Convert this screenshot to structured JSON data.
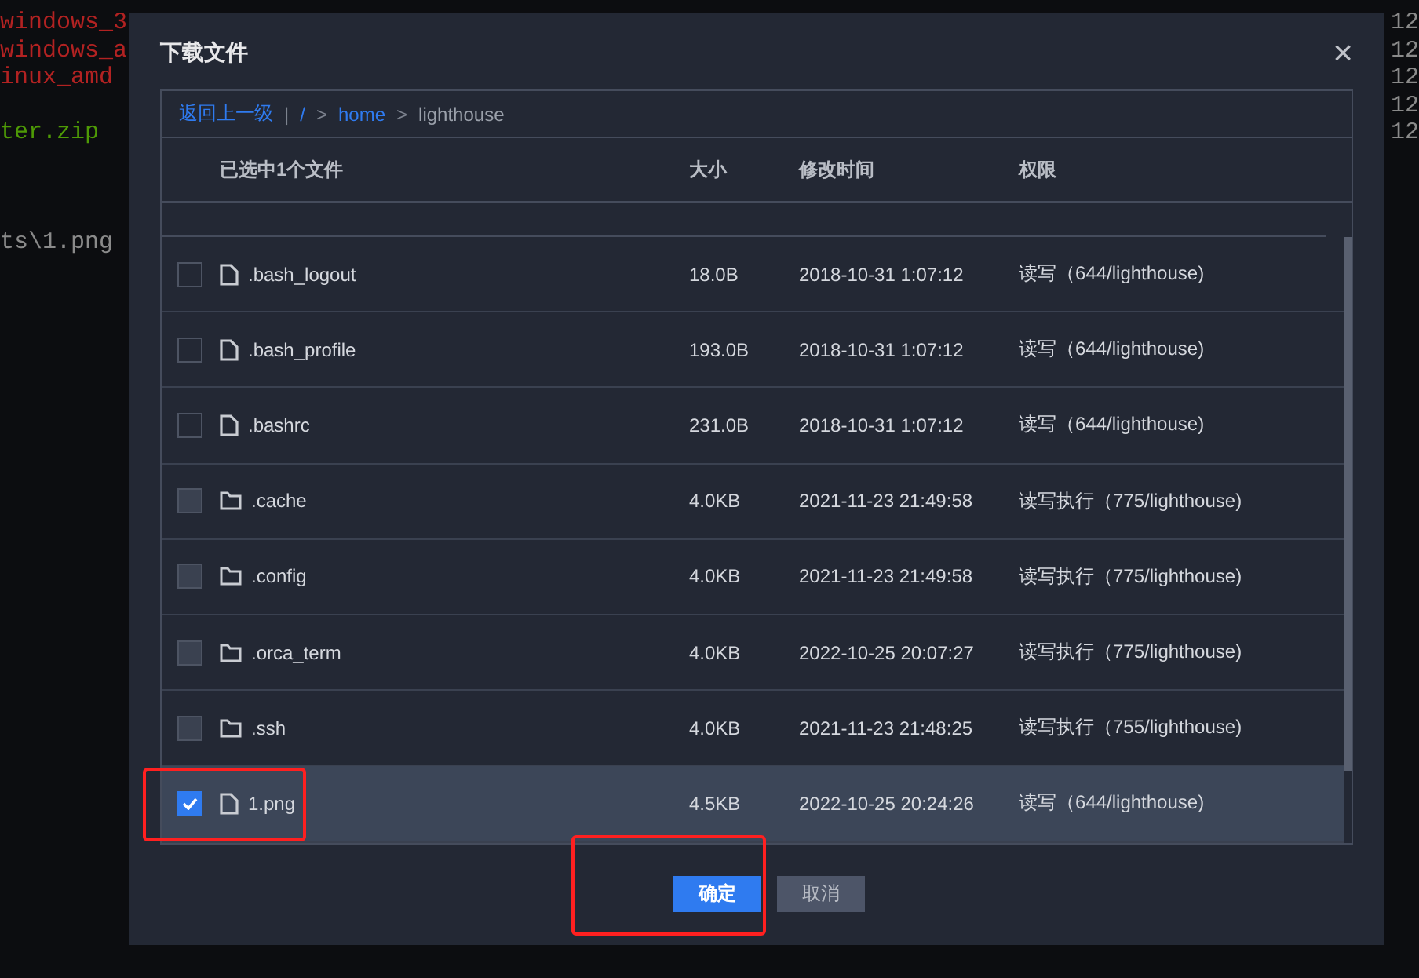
{
  "terminal": {
    "left_lines": [
      {
        "text": "windows_3",
        "color": "#b22222"
      },
      {
        "text": "windows_a",
        "color": "#b22222"
      },
      {
        "text": "inux_amd",
        "color": "#b22222"
      },
      {
        "text": "ter.zip",
        "color": "#4e9a06"
      },
      {
        "text": "ts\\1.png",
        "color": "#8a8a8a"
      }
    ],
    "right_lines": [
      "12",
      "12",
      "12",
      "12",
      "12"
    ]
  },
  "dialog": {
    "title": "下载文件",
    "close": "×",
    "breadcrumb": {
      "back": "返回上一级",
      "separator": "|",
      "root": "/",
      "arrow": ">",
      "path": [
        {
          "label": "home",
          "current": false
        },
        {
          "label": "lighthouse",
          "current": true
        }
      ]
    },
    "table": {
      "columns": [
        "已选中1个文件",
        "大小",
        "修改时间",
        "权限"
      ],
      "rows": [
        {
          "kind": "file",
          "name": ".bash_logout",
          "size": "18.0B",
          "modified": "2018-10-31 1:07:12",
          "permission": "读写（644/lighthouse)",
          "checked": false,
          "highlighted": false
        },
        {
          "kind": "file",
          "name": ".bash_profile",
          "size": "193.0B",
          "modified": "2018-10-31 1:07:12",
          "permission": "读写（644/lighthouse)",
          "checked": false,
          "highlighted": false
        },
        {
          "kind": "file",
          "name": ".bashrc",
          "size": "231.0B",
          "modified": "2018-10-31 1:07:12",
          "permission": "读写（644/lighthouse)",
          "checked": false,
          "highlighted": false
        },
        {
          "kind": "folder",
          "name": ".cache",
          "size": "4.0KB",
          "modified": "2021-11-23 21:49:58",
          "permission": "读写执行（775/lighthouse)",
          "checked": false,
          "highlighted": false
        },
        {
          "kind": "folder",
          "name": ".config",
          "size": "4.0KB",
          "modified": "2021-11-23 21:49:58",
          "permission": "读写执行（775/lighthouse)",
          "checked": false,
          "highlighted": false
        },
        {
          "kind": "folder",
          "name": ".orca_term",
          "size": "4.0KB",
          "modified": "2022-10-25 20:07:27",
          "permission": "读写执行（775/lighthouse)",
          "checked": false,
          "highlighted": false
        },
        {
          "kind": "folder",
          "name": ".ssh",
          "size": "4.0KB",
          "modified": "2021-11-23 21:48:25",
          "permission": "读写执行（755/lighthouse)",
          "checked": false,
          "highlighted": false
        },
        {
          "kind": "file",
          "name": "1.png",
          "size": "4.5KB",
          "modified": "2022-10-25 20:24:26",
          "permission": "读写（644/lighthouse)",
          "checked": true,
          "highlighted": true
        }
      ]
    },
    "buttons": [
      {
        "label": "确定",
        "kind": "primary",
        "highlighted": true
      },
      {
        "label": "取消",
        "kind": "secondary"
      }
    ]
  }
}
